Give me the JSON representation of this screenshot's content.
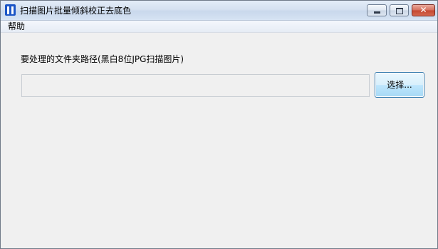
{
  "window": {
    "title": "扫描图片批量倾斜校正去底色",
    "close_glyph": "✕"
  },
  "menu": {
    "items": [
      {
        "label": "帮助"
      }
    ]
  },
  "main": {
    "path_label": "要处理的文件夹路径(黑白8位JPG扫描图片)",
    "path_input_value": "",
    "choose_button_label": "选择..."
  },
  "colors": {
    "titlebar": "#d5e1f0",
    "window_bg": "#f0f0f0",
    "button_accent": "#3c7fb1",
    "close_button": "#c44730"
  }
}
